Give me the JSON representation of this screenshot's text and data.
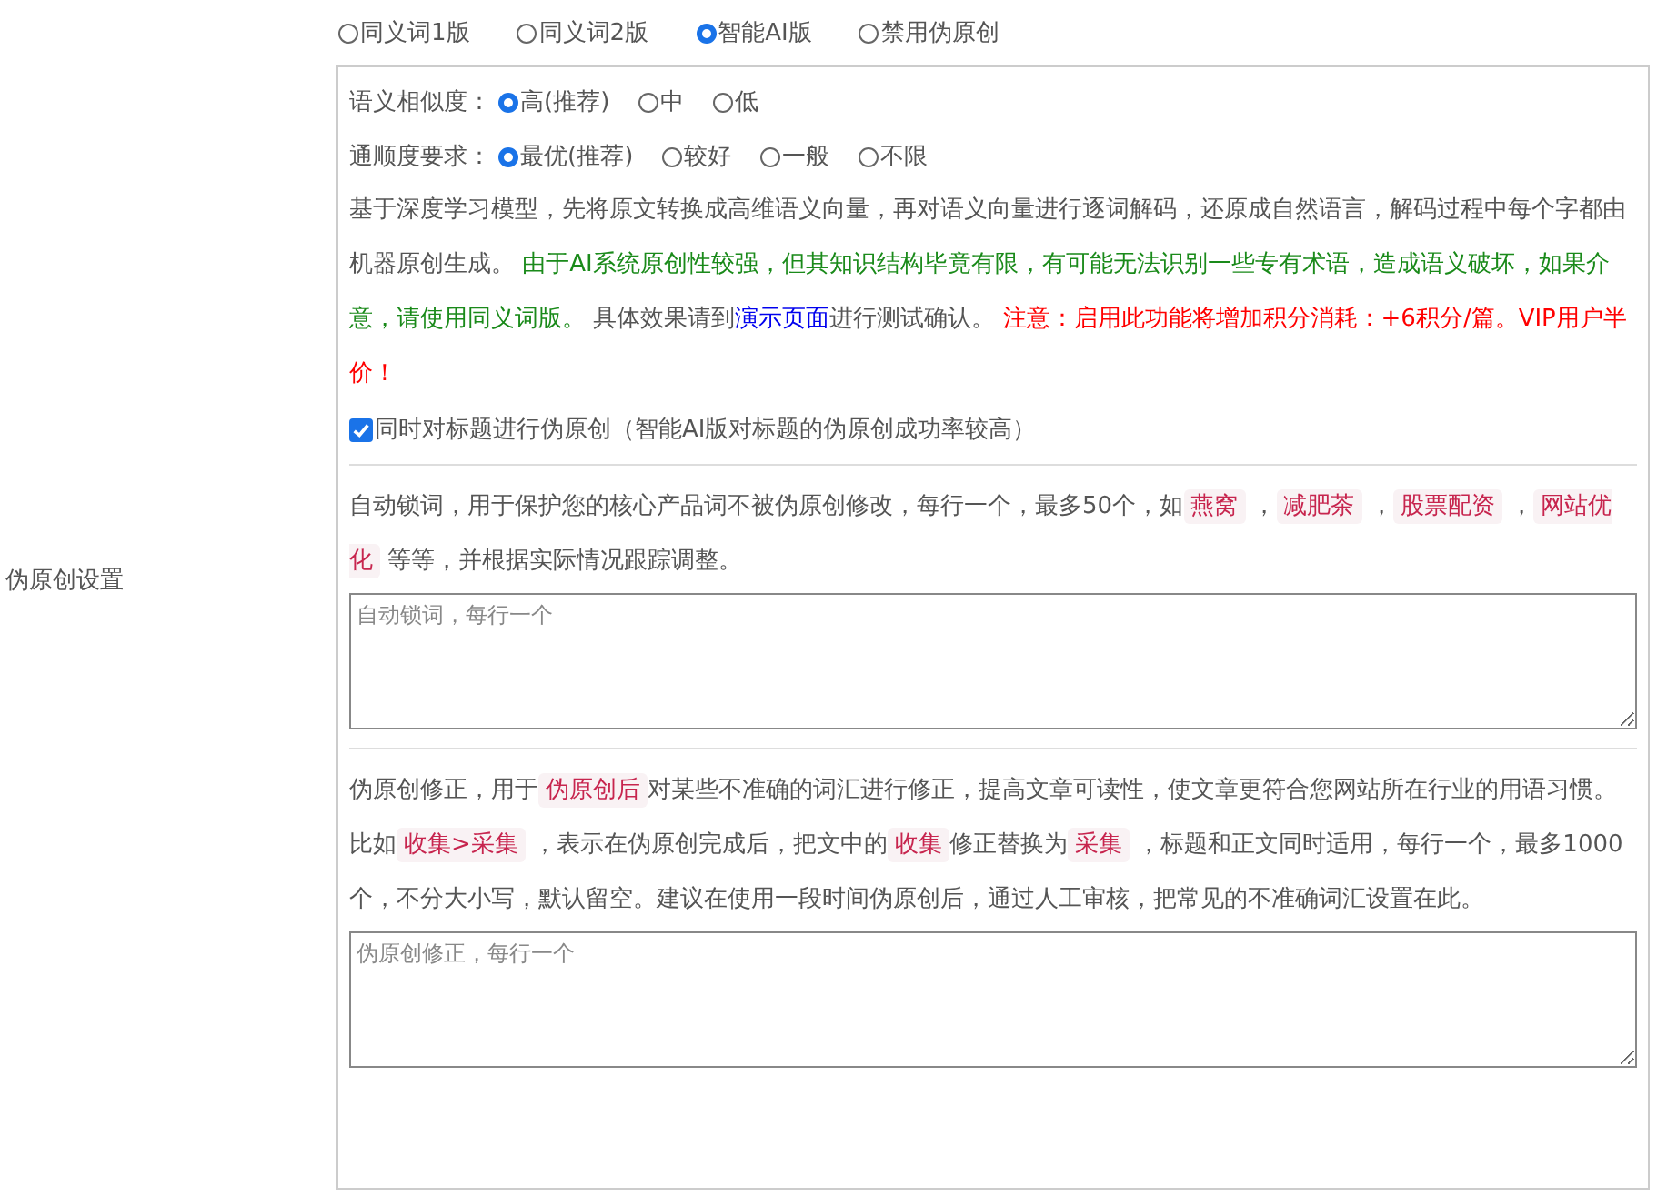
{
  "row_label": "伪原创设置",
  "modes": [
    {
      "label": "同义词1版",
      "selected": false
    },
    {
      "label": "同义词2版",
      "selected": false
    },
    {
      "label": "智能AI版",
      "selected": true
    },
    {
      "label": "禁用伪原创",
      "selected": false
    }
  ],
  "option_groups": [
    {
      "label": "语义相似度：",
      "options": [
        {
          "label": "高(推荐)",
          "selected": true
        },
        {
          "label": "中",
          "selected": false
        },
        {
          "label": "低",
          "selected": false
        }
      ]
    },
    {
      "label": "通顺度要求：",
      "options": [
        {
          "label": "最优(推荐)",
          "selected": true
        },
        {
          "label": "较好",
          "selected": false
        },
        {
          "label": "一般",
          "selected": false
        },
        {
          "label": "不限",
          "selected": false
        }
      ]
    }
  ],
  "ai_description": [
    {
      "kind": "text",
      "text": "基于深度学习模型，先将原文转换成高维语义向量，再对语义向量进行逐词解码，还原成自然语言，解码过程中每个字都由机器原创生成。 "
    },
    {
      "kind": "green",
      "text": "由于AI系统原创性较强，但其知识结构毕竟有限，有可能无法识别一些专有术语，造成语义破坏，如果介意，请使用同义词版。"
    },
    {
      "kind": "text",
      "text": " 具体效果请到"
    },
    {
      "kind": "link",
      "text": "演示页面"
    },
    {
      "kind": "text",
      "text": "进行测试确认。 "
    },
    {
      "kind": "red",
      "text": "注意：启用此功能将增加积分消耗：+6积分/篇。VIP用户半价！"
    }
  ],
  "title_rewrite": {
    "label": "同时对标题进行伪原创（智能AI版对标题的伪原创成功率较高）",
    "checked": true
  },
  "lock_words": {
    "description": [
      {
        "kind": "text",
        "text": "自动锁词，用于保护您的核心产品词不被伪原创修改，每行一个，最多50个，如"
      },
      {
        "kind": "code",
        "text": "燕窝"
      },
      {
        "kind": "text",
        "text": " ，"
      },
      {
        "kind": "code",
        "text": "减肥茶"
      },
      {
        "kind": "text",
        "text": " ，"
      },
      {
        "kind": "code",
        "text": "股票配资"
      },
      {
        "kind": "text",
        "text": " ，"
      },
      {
        "kind": "code",
        "text": "网站优化"
      },
      {
        "kind": "text",
        "text": " 等等，并根据实际情况跟踪调整。"
      }
    ],
    "placeholder": "自动锁词，每行一个"
  },
  "corrections": {
    "description": [
      {
        "kind": "text",
        "text": "伪原创修正，用于"
      },
      {
        "kind": "code",
        "text": "伪原创后"
      },
      {
        "kind": "text",
        "text": "对某些不准确的词汇进行修正，提高文章可读性，使文章更符合您网站所在行业的用语习惯。比如"
      },
      {
        "kind": "code",
        "text": "收集>采集"
      },
      {
        "kind": "text",
        "text": " ，表示在伪原创完成后，把文中的"
      },
      {
        "kind": "code",
        "text": "收集"
      },
      {
        "kind": "text",
        "text": "修正替换为"
      },
      {
        "kind": "code",
        "text": "采集"
      },
      {
        "kind": "text",
        "text": " ，标题和正文同时适用，每行一个，最多1000个，不分大小写，默认留空。建议在使用一段时间伪原创后，通过人工审核，把常见的不准确词汇设置在此。"
      }
    ],
    "placeholder": "伪原创修正，每行一个"
  }
}
